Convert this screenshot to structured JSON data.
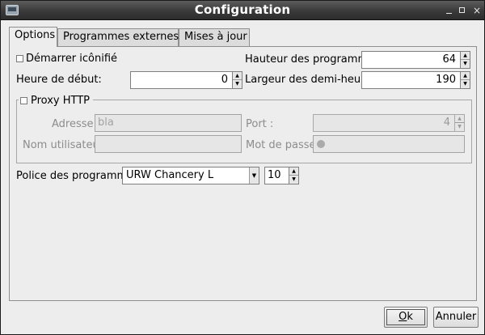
{
  "window": {
    "title": "Configuration",
    "controls": [
      "minimize-icon",
      "maximize-icon",
      "close-icon"
    ],
    "close_glyph": "×"
  },
  "tabs": [
    {
      "label": "Options",
      "active": true
    },
    {
      "label": "Programmes externes",
      "active": false
    },
    {
      "label": "Mises à jour",
      "active": false
    }
  ],
  "options": {
    "start_minimized": {
      "label": "Démarrer icônifié",
      "checked": false
    },
    "start_hour": {
      "label": "Heure de début:",
      "value": "0"
    },
    "program_height": {
      "label": "Hauteur des programmes",
      "value": "64"
    },
    "half_hour_width": {
      "label": "Largeur des demi-heures",
      "value": "190"
    }
  },
  "proxy": {
    "enabled": {
      "label": "Proxy HTTP",
      "checked": false
    },
    "address": {
      "label": "Adresse:",
      "value": "bla"
    },
    "port": {
      "label": "Port :",
      "value": "4"
    },
    "username": {
      "label": "Nom utilisateur:",
      "value": ""
    },
    "password": {
      "label": "Mot de passe:",
      "masked": true
    }
  },
  "font": {
    "label": "Police des programmes",
    "family": "URW Chancery L",
    "size": "10"
  },
  "buttons": {
    "ok": {
      "label": "Ok",
      "underline": "O",
      "rest": "k"
    },
    "cancel": {
      "label": "Annuler"
    }
  },
  "colors": {
    "titlebar": "#3a3a3a",
    "dialog_bg": "#ededed",
    "disabled_text": "#8c8c8c"
  }
}
